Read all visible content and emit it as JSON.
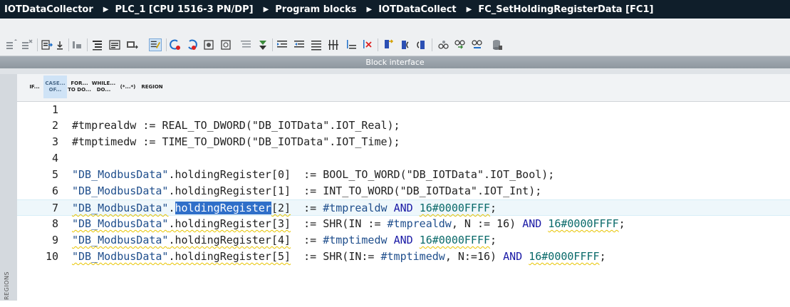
{
  "breadcrumb": [
    "IOTDataCollector",
    "PLC_1 [CPU 1516-3 PN/DP]",
    "Program blocks",
    "IOTDataCollect",
    "FC_SetHoldingRegisterData [FC1]"
  ],
  "block_interface_label": "Block interface",
  "regions_label": "REGIONS",
  "palette": [
    {
      "line1": "IF...",
      "line2": ""
    },
    {
      "line1": "CASE...",
      "line2": "OF..."
    },
    {
      "line1": "FOR...",
      "line2": "TO DO..."
    },
    {
      "line1": "WHILE...",
      "line2": "DO..."
    },
    {
      "line1": "(*...*)",
      "line2": ""
    },
    {
      "line1": "REGION",
      "line2": ""
    }
  ],
  "code": {
    "line_numbers": [
      "1",
      "2",
      "3",
      "4",
      "5",
      "6",
      "7",
      "8",
      "9",
      "10"
    ],
    "l2": {
      "a": "#tmprealdw",
      "b": " := ",
      "c": "REAL_TO_DWORD(",
      "d": "\"DB_IOTData\"",
      "e": ".IOT_Real);"
    },
    "l3": {
      "a": "#tmptimedw",
      "b": " := ",
      "c": "TIME_TO_DWORD(",
      "d": "\"DB_IOTData\"",
      "e": ".IOT_Time);"
    },
    "l5": {
      "db": "\"DB_ModbusData\"",
      "mem": ".holdingRegister[0]",
      "op": "  := ",
      "fn": "BOOL_TO_WORD(",
      "arg": "\"DB_IOTData\"",
      "rest": ".IOT_Bool);"
    },
    "l6": {
      "db": "\"DB_ModbusData\"",
      "mem": ".holdingRegister[1]",
      "op": "  := ",
      "fn": "INT_TO_WORD(",
      "arg": "\"DB_IOTData\"",
      "rest": ".IOT_Int);"
    },
    "l7": {
      "db": "\"DB_ModbusData\"",
      "dot": ".",
      "sel": "holdingRegister",
      "idx": "[2]",
      "op": "  := ",
      "var": "#tmprealdw",
      "kw": "AND",
      "hex": "16#0000FFFF",
      "end": ";"
    },
    "l8": {
      "db": "\"DB_ModbusData\"",
      "mem": ".holdingRegister[3]",
      "op": "  := ",
      "fn": "SHR(IN := ",
      "var": "#tmprealdw",
      "mid": ", N := 16) ",
      "kw": "AND",
      "hex": "16#0000FFFF",
      "end": ";"
    },
    "l9": {
      "db": "\"DB_ModbusData\"",
      "mem": ".holdingRegister[4]",
      "op": "  := ",
      "var": "#tmptimedw",
      "kw": "AND",
      "hex": "16#0000FFFF",
      "end": ";"
    },
    "l10": {
      "db": "\"DB_ModbusData\"",
      "mem": ".holdingRegister[5]",
      "op": "  := ",
      "fn": "SHR(IN:= ",
      "var": "#tmptimedw",
      "mid": ", N:=16) ",
      "kw": "AND",
      "hex": "16#0000FFFF",
      "end": ";"
    }
  },
  "colors": {
    "titlebar": "#0f1e2a",
    "selection": "#2f6fc9",
    "current_line": "#eef7fb",
    "squiggle": "#e8c400"
  },
  "toolbar_icons": [
    "insert-network-icon",
    "delete-network-icon",
    "export-icon",
    "download-icon",
    "compile-icon",
    "block-properties-icon",
    "absolute-operands-icon",
    "monitor-icon",
    "toggle-comment-icon",
    "go-to-error-back-icon",
    "go-to-error-next-icon",
    "add-comment-icon",
    "remove-comment-icon",
    "show-comments-icon",
    "bookmark-icon",
    "indent-icon",
    "outdent-icon",
    "align-icon",
    "format-icon",
    "set-bookmark-icon",
    "prev-bookmark-icon",
    "next-bookmark-icon",
    "watch-icon",
    "monitoring-on-icon",
    "glasses-icon",
    "database-icon"
  ]
}
